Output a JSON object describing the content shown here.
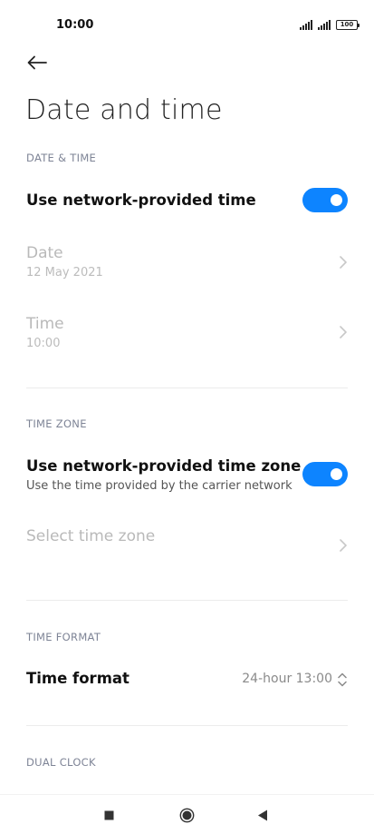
{
  "status_bar": {
    "time": "10:00",
    "battery": "100",
    "icons": [
      "signal-icon",
      "signal-icon",
      "battery-icon"
    ]
  },
  "header": {
    "back_icon": "arrow-left-icon",
    "title": "Date and time"
  },
  "sections": {
    "date_time": {
      "header": "DATE & TIME",
      "network_time": {
        "label": "Use network-provided time",
        "enabled": true
      },
      "date": {
        "label": "Date",
        "value": "12 May 2021"
      },
      "time": {
        "label": "Time",
        "value": "10:00"
      }
    },
    "time_zone": {
      "header": "TIME ZONE",
      "network_zone": {
        "label": "Use network-provided time zone",
        "description": "Use the time provided by the carrier network",
        "enabled": true
      },
      "select_zone": {
        "label": "Select time zone"
      }
    },
    "time_format": {
      "header": "TIME FORMAT",
      "row": {
        "label": "Time format",
        "value": "24-hour 13:00"
      }
    },
    "dual_clock": {
      "header": "DUAL CLOCK"
    }
  },
  "nav_bar": {
    "icons": [
      "recents-square-icon",
      "home-circle-icon",
      "back-triangle-icon"
    ]
  },
  "colors": {
    "accent": "#0d84ff",
    "section_header": "#7e8496",
    "disabled_text": "#b9b9b9"
  }
}
